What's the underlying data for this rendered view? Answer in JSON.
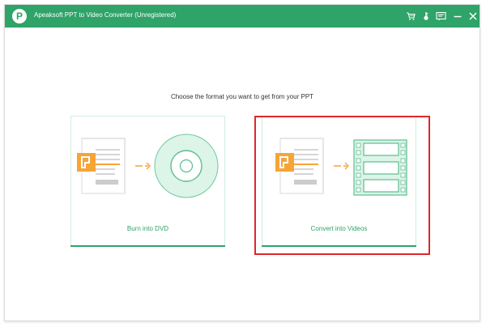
{
  "titlebar": {
    "logo_letter": "P",
    "title": "Apeaksoft PPT to Video Converter (Unregistered)",
    "icons": [
      "cart-icon",
      "key-icon",
      "feedback-icon",
      "minimize-icon",
      "close-icon"
    ]
  },
  "main": {
    "prompt": "Choose the format you want to get from your PPT",
    "options": [
      {
        "label": "Burn into DVD",
        "icon": "ppt-to-dvd-icon"
      },
      {
        "label": "Convert into Videos",
        "icon": "ppt-to-video-icon"
      }
    ]
  },
  "colors": {
    "titlebar": "#2fa368",
    "accent": "#2fa368",
    "orange": "#f7a437",
    "highlight": "#e0262a"
  }
}
